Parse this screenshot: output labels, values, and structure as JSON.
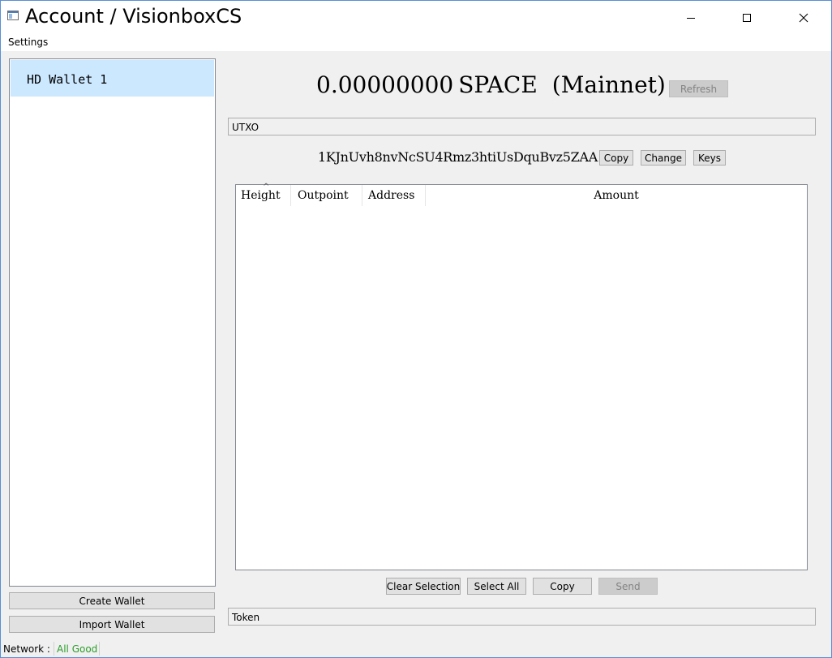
{
  "window": {
    "title": "Account / VisionboxCS",
    "icons": {
      "app": "app-icon",
      "minimize": "minimize-icon",
      "maximize": "maximize-icon",
      "close": "close-icon"
    }
  },
  "menu": {
    "settings": "Settings"
  },
  "wallets": {
    "items": [
      {
        "label": "HD Wallet 1",
        "selected": true
      }
    ],
    "create_button": "Create Wallet",
    "import_button": "Import Wallet"
  },
  "balance": {
    "amount": "0.00000000",
    "unit": "SPACE",
    "network": "(Mainnet)",
    "refresh_button": "Refresh"
  },
  "utxo": {
    "group_label": "UTXO",
    "address": "1KJnUvh8nvNcSU4Rmz3htiUsDquBvz5ZAA",
    "copy_button": "Copy",
    "change_button": "Change",
    "keys_button": "Keys",
    "columns": [
      "Height",
      "Outpoint",
      "Address",
      "Amount"
    ],
    "sort_indicator": "^",
    "rows": [],
    "clear_selection_button": "Clear Selection",
    "select_all_button": "Select All",
    "copy_rows_button": "Copy",
    "send_button": "Send"
  },
  "token": {
    "group_label": "Token"
  },
  "status": {
    "label": "Network :",
    "value": "All Good",
    "value_color": "#2a9d2a"
  },
  "colors": {
    "selection": "#cce8ff",
    "window_border": "#5a8fd6"
  }
}
